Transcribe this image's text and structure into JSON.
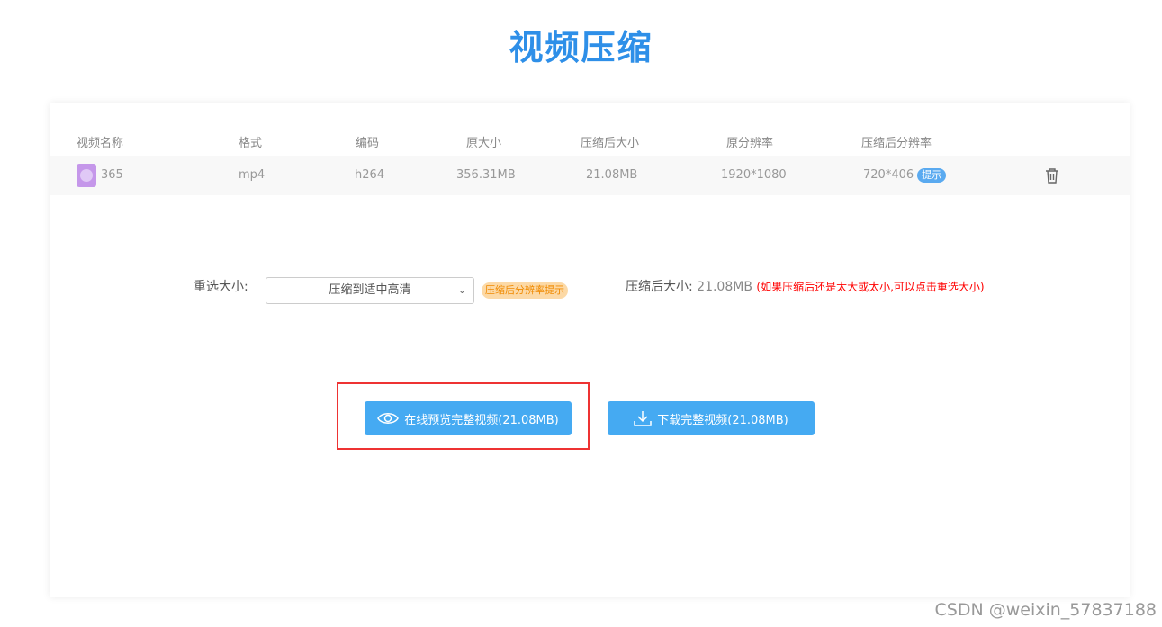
{
  "title": "视频压缩",
  "table": {
    "headers": [
      "视频名称",
      "格式",
      "编码",
      "原大小",
      "压缩后大小",
      "原分辨率",
      "压缩后分辨率"
    ],
    "row": {
      "name": "365",
      "format": "mp4",
      "codec": "h264",
      "orig_size": "356.31MB",
      "comp_size": "21.08MB",
      "orig_res": "1920*1080",
      "comp_res": "720*406",
      "tip": "提示"
    }
  },
  "controls": {
    "reselect_label": "重选大小:",
    "select_value": "压缩到适中高清",
    "res_tip": "压缩后分辨率提示",
    "size_label": "压缩后大小:",
    "size_value": "21.08MB",
    "note": "(如果压缩后还是太大或太小,可以点击重选大小)"
  },
  "buttons": {
    "preview": "在线预览完整视频(21.08MB)",
    "download": "下载完整视频(21.08MB)"
  },
  "watermark": "CSDN @weixin_57837188"
}
